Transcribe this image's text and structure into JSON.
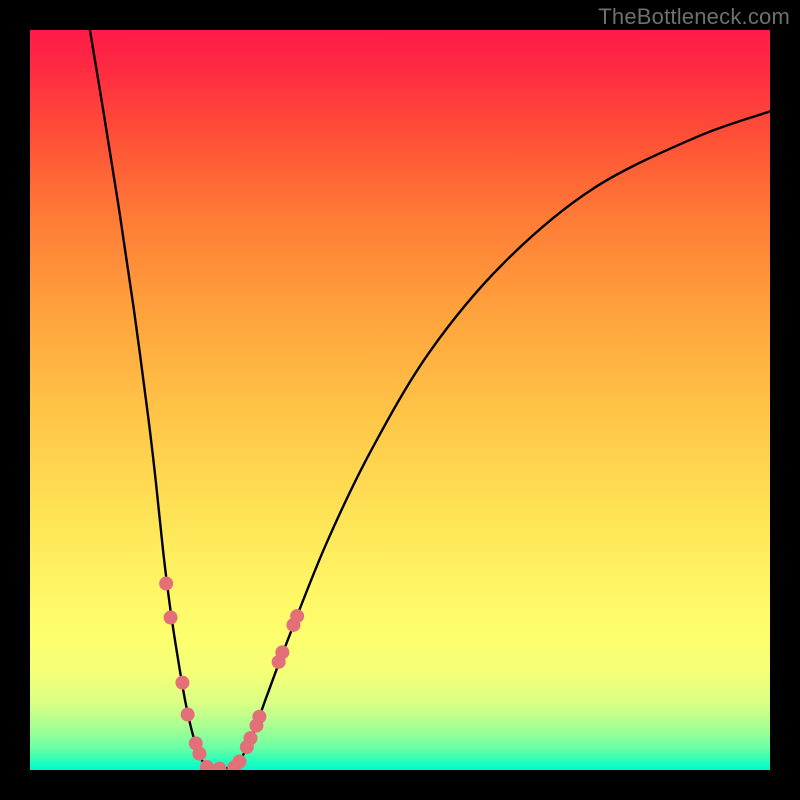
{
  "watermark": "TheBottleneck.com",
  "chart_data": {
    "type": "line",
    "title": "",
    "xlabel": "",
    "ylabel": "",
    "xlim": [
      0,
      100
    ],
    "ylim": [
      0,
      100
    ],
    "grid": false,
    "series": [
      {
        "name": "curve-left",
        "x": [
          8.1,
          10,
          12,
          14,
          16,
          17,
          18,
          19,
          20,
          21,
          22,
          23,
          23.8
        ],
        "y": [
          100,
          88.5,
          76,
          62.5,
          47.5,
          39,
          29.5,
          21.5,
          15,
          9.2,
          4.8,
          1.8,
          0.4
        ]
      },
      {
        "name": "curve-flat",
        "x": [
          23.8,
          25.5,
          27.5
        ],
        "y": [
          0.4,
          0.2,
          0.35
        ]
      },
      {
        "name": "curve-right",
        "x": [
          27.5,
          28.5,
          30,
          32,
          35,
          40,
          46,
          54,
          64,
          76,
          90,
          100
        ],
        "y": [
          0.35,
          1.5,
          4.5,
          10,
          18,
          30.5,
          43,
          56.5,
          68.5,
          78.5,
          85.5,
          89
        ]
      }
    ],
    "markers": {
      "name": "highlight-points",
      "color": "#e36f79",
      "radius": 7,
      "points": [
        {
          "x": 18.4,
          "y": 25.2
        },
        {
          "x": 19.0,
          "y": 20.6
        },
        {
          "x": 20.6,
          "y": 11.8
        },
        {
          "x": 21.3,
          "y": 7.5
        },
        {
          "x": 22.4,
          "y": 3.6
        },
        {
          "x": 22.9,
          "y": 2.2
        },
        {
          "x": 23.9,
          "y": 0.4
        },
        {
          "x": 25.6,
          "y": 0.2
        },
        {
          "x": 27.6,
          "y": 0.35
        },
        {
          "x": 28.3,
          "y": 1.15
        },
        {
          "x": 29.3,
          "y": 3.1
        },
        {
          "x": 29.8,
          "y": 4.3
        },
        {
          "x": 30.6,
          "y": 6.0
        },
        {
          "x": 31.0,
          "y": 7.2
        },
        {
          "x": 33.6,
          "y": 14.6
        },
        {
          "x": 34.1,
          "y": 15.9
        },
        {
          "x": 35.6,
          "y": 19.6
        },
        {
          "x": 36.1,
          "y": 20.8
        }
      ]
    }
  }
}
